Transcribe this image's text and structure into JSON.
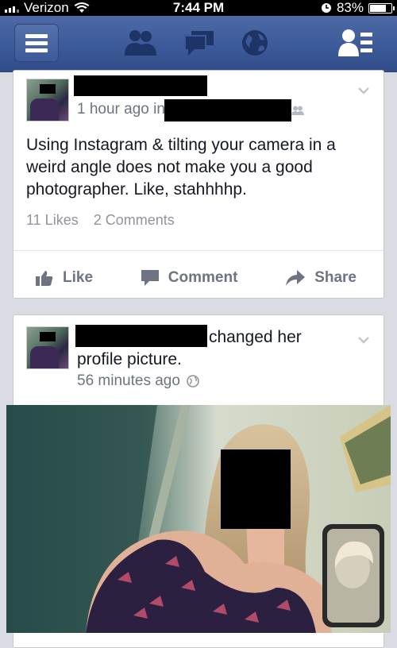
{
  "status_bar": {
    "carrier": "Verizon",
    "time": "7:44 PM",
    "battery": "83%",
    "battery_level": 0.83
  },
  "navbar": {
    "menu_icon": "menu-icon",
    "friend_requests_icon": "friends-icon",
    "messages_icon": "messages-icon",
    "notifications_icon": "globe-icon",
    "right_icon": "contacts-list-icon",
    "brand_color": "#3b5998"
  },
  "post1": {
    "timestamp": "1 hour ago in",
    "text": "Using Instagram & tilting your camera in a weird angle does not make you a good photographer. Like, stahhhhp.",
    "likes": "11 Likes",
    "comments": "2 Comments",
    "actions": {
      "like": "Like",
      "comment": "Comment",
      "share": "Share"
    }
  },
  "post2": {
    "text_line1": "changed her",
    "text_line2": "profile picture.",
    "timestamp": "56 minutes ago"
  }
}
